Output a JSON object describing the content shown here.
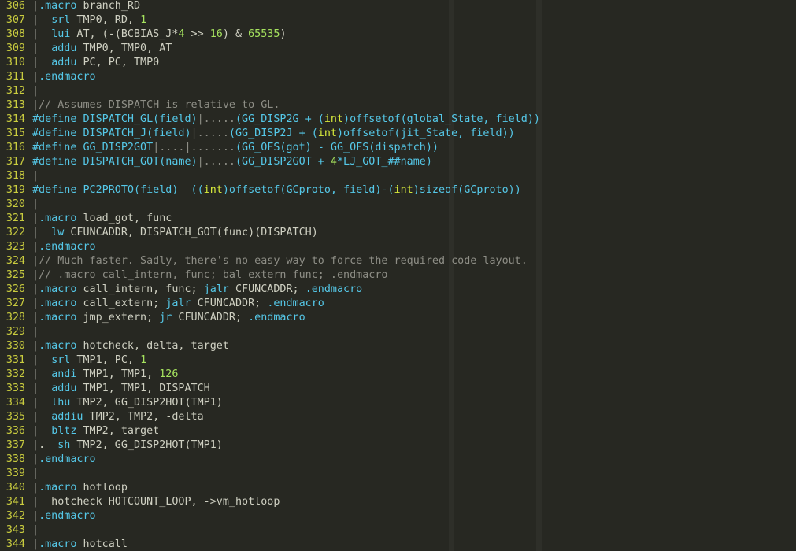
{
  "editor": {
    "colors": {
      "background": "#272822",
      "line_number": "#c9cc3f",
      "text": "#cfd0c2",
      "keyword": "#55c8e8",
      "number": "#a5e25e",
      "comment": "#8e8e86",
      "type": "#d6e93b"
    },
    "lines": [
      {
        "n": "306",
        "s": [
          [
            "bar",
            "|"
          ],
          [
            "kw",
            ".macro"
          ],
          [
            "c",
            " branch_RD"
          ]
        ]
      },
      {
        "n": "307",
        "s": [
          [
            "bar",
            "|"
          ],
          [
            "c",
            "  "
          ],
          [
            "kw",
            "srl"
          ],
          [
            "c",
            " TMP0, RD, "
          ],
          [
            "num",
            "1"
          ]
        ]
      },
      {
        "n": "308",
        "s": [
          [
            "bar",
            "|"
          ],
          [
            "c",
            "  "
          ],
          [
            "kw",
            "lui"
          ],
          [
            "c",
            " AT, (-(BCBIAS_J*"
          ],
          [
            "num",
            "4"
          ],
          [
            "c",
            " >> "
          ],
          [
            "num",
            "16"
          ],
          [
            "c",
            ") & "
          ],
          [
            "num",
            "65535"
          ],
          [
            "c",
            ")"
          ]
        ]
      },
      {
        "n": "309",
        "s": [
          [
            "bar",
            "|"
          ],
          [
            "c",
            "  "
          ],
          [
            "kw",
            "addu"
          ],
          [
            "c",
            " TMP0, TMP0, AT"
          ]
        ]
      },
      {
        "n": "310",
        "s": [
          [
            "bar",
            "|"
          ],
          [
            "c",
            "  "
          ],
          [
            "kw",
            "addu"
          ],
          [
            "c",
            " PC, PC, TMP0"
          ]
        ]
      },
      {
        "n": "311",
        "s": [
          [
            "bar",
            "|"
          ],
          [
            "kw",
            ".endmacro"
          ]
        ]
      },
      {
        "n": "312",
        "s": [
          [
            "bar",
            "|"
          ]
        ]
      },
      {
        "n": "313",
        "s": [
          [
            "bar",
            "|"
          ],
          [
            "cm",
            "// Assumes DISPATCH is relative to GL."
          ]
        ]
      },
      {
        "n": "314",
        "s": [
          [
            "pre",
            "#define DISPATCH_GL(field)"
          ],
          [
            "cm",
            "|....."
          ],
          [
            "pre",
            "(GG_DISP2G + ("
          ],
          [
            "ty",
            "int"
          ],
          [
            "pre",
            ")offsetof(global_State, field))"
          ]
        ]
      },
      {
        "n": "315",
        "s": [
          [
            "pre",
            "#define DISPATCH_J(field)"
          ],
          [
            "cm",
            "|....."
          ],
          [
            "pre",
            "(GG_DISP2J + ("
          ],
          [
            "ty",
            "int"
          ],
          [
            "pre",
            ")offsetof(jit_State, field))"
          ]
        ]
      },
      {
        "n": "316",
        "s": [
          [
            "pre",
            "#define GG_DISP2GOT"
          ],
          [
            "cm",
            "|....|......."
          ],
          [
            "pre",
            "(GG_OFS(got) - GG_OFS(dispatch))"
          ]
        ]
      },
      {
        "n": "317",
        "s": [
          [
            "pre",
            "#define DISPATCH_GOT(name)"
          ],
          [
            "cm",
            "|....."
          ],
          [
            "pre",
            "(GG_DISP2GOT + "
          ],
          [
            "num",
            "4"
          ],
          [
            "pre",
            "*LJ_GOT_##name)"
          ]
        ]
      },
      {
        "n": "318",
        "s": [
          [
            "bar",
            "|"
          ]
        ]
      },
      {
        "n": "319",
        "s": [
          [
            "pre",
            "#define PC2PROTO(field)  (("
          ],
          [
            "ty",
            "int"
          ],
          [
            "pre",
            ")offsetof(GCproto, field)-("
          ],
          [
            "ty",
            "int"
          ],
          [
            "pre",
            ")sizeof(GCproto))"
          ]
        ]
      },
      {
        "n": "320",
        "s": [
          [
            "bar",
            "|"
          ]
        ]
      },
      {
        "n": "321",
        "s": [
          [
            "bar",
            "|"
          ],
          [
            "kw",
            ".macro"
          ],
          [
            "c",
            " load_got, func"
          ]
        ]
      },
      {
        "n": "322",
        "s": [
          [
            "bar",
            "|"
          ],
          [
            "c",
            "  "
          ],
          [
            "kw",
            "lw"
          ],
          [
            "c",
            " CFUNCADDR, DISPATCH_GOT(func)(DISPATCH)"
          ]
        ]
      },
      {
        "n": "323",
        "s": [
          [
            "bar",
            "|"
          ],
          [
            "kw",
            ".endmacro"
          ]
        ]
      },
      {
        "n": "324",
        "s": [
          [
            "bar",
            "|"
          ],
          [
            "cm",
            "// Much faster. Sadly, there's no easy way to force the required code layout."
          ]
        ]
      },
      {
        "n": "325",
        "s": [
          [
            "bar",
            "|"
          ],
          [
            "cm",
            "// .macro call_intern, func; bal extern func; .endmacro"
          ]
        ]
      },
      {
        "n": "326",
        "s": [
          [
            "bar",
            "|"
          ],
          [
            "kw",
            ".macro"
          ],
          [
            "c",
            " call_intern, func; "
          ],
          [
            "kw",
            "jalr"
          ],
          [
            "c",
            " CFUNCADDR; "
          ],
          [
            "kw",
            ".endmacro"
          ]
        ]
      },
      {
        "n": "327",
        "s": [
          [
            "bar",
            "|"
          ],
          [
            "kw",
            ".macro"
          ],
          [
            "c",
            " call_extern; "
          ],
          [
            "kw",
            "jalr"
          ],
          [
            "c",
            " CFUNCADDR; "
          ],
          [
            "kw",
            ".endmacro"
          ]
        ]
      },
      {
        "n": "328",
        "s": [
          [
            "bar",
            "|"
          ],
          [
            "kw",
            ".macro"
          ],
          [
            "c",
            " jmp_extern; "
          ],
          [
            "kw",
            "jr"
          ],
          [
            "c",
            " CFUNCADDR; "
          ],
          [
            "kw",
            ".endmacro"
          ]
        ]
      },
      {
        "n": "329",
        "s": [
          [
            "bar",
            "|"
          ]
        ]
      },
      {
        "n": "330",
        "s": [
          [
            "bar",
            "|"
          ],
          [
            "kw",
            ".macro"
          ],
          [
            "c",
            " hotcheck, delta, target"
          ]
        ]
      },
      {
        "n": "331",
        "s": [
          [
            "bar",
            "|"
          ],
          [
            "c",
            "  "
          ],
          [
            "kw",
            "srl"
          ],
          [
            "c",
            " TMP1, PC, "
          ],
          [
            "num",
            "1"
          ]
        ]
      },
      {
        "n": "332",
        "s": [
          [
            "bar",
            "|"
          ],
          [
            "c",
            "  "
          ],
          [
            "kw",
            "andi"
          ],
          [
            "c",
            " TMP1, TMP1, "
          ],
          [
            "num",
            "126"
          ]
        ]
      },
      {
        "n": "333",
        "s": [
          [
            "bar",
            "|"
          ],
          [
            "c",
            "  "
          ],
          [
            "kw",
            "addu"
          ],
          [
            "c",
            " TMP1, TMP1, DISPATCH"
          ]
        ]
      },
      {
        "n": "334",
        "s": [
          [
            "bar",
            "|"
          ],
          [
            "c",
            "  "
          ],
          [
            "kw",
            "lhu"
          ],
          [
            "c",
            " TMP2, GG_DISP2HOT(TMP1)"
          ]
        ]
      },
      {
        "n": "335",
        "s": [
          [
            "bar",
            "|"
          ],
          [
            "c",
            "  "
          ],
          [
            "kw",
            "addiu"
          ],
          [
            "c",
            " TMP2, TMP2, -delta"
          ]
        ]
      },
      {
        "n": "336",
        "s": [
          [
            "bar",
            "|"
          ],
          [
            "c",
            "  "
          ],
          [
            "kw",
            "bltz"
          ],
          [
            "c",
            " TMP2, target"
          ]
        ]
      },
      {
        "n": "337",
        "s": [
          [
            "bar",
            "|"
          ],
          [
            "c",
            ".  "
          ],
          [
            "kw",
            "sh"
          ],
          [
            "c",
            " TMP2, GG_DISP2HOT(TMP1)"
          ]
        ]
      },
      {
        "n": "338",
        "s": [
          [
            "bar",
            "|"
          ],
          [
            "kw",
            ".endmacro"
          ]
        ]
      },
      {
        "n": "339",
        "s": [
          [
            "bar",
            "|"
          ]
        ]
      },
      {
        "n": "340",
        "s": [
          [
            "bar",
            "|"
          ],
          [
            "kw",
            ".macro"
          ],
          [
            "c",
            " hotloop"
          ]
        ]
      },
      {
        "n": "341",
        "s": [
          [
            "bar",
            "|"
          ],
          [
            "c",
            "  hotcheck HOTCOUNT_LOOP, ->vm_hotloop"
          ]
        ]
      },
      {
        "n": "342",
        "s": [
          [
            "bar",
            "|"
          ],
          [
            "kw",
            ".endmacro"
          ]
        ]
      },
      {
        "n": "343",
        "s": [
          [
            "bar",
            "|"
          ]
        ]
      },
      {
        "n": "344",
        "s": [
          [
            "bar",
            "|"
          ],
          [
            "kw",
            ".macro"
          ],
          [
            "c",
            " hotcall"
          ]
        ]
      }
    ]
  }
}
